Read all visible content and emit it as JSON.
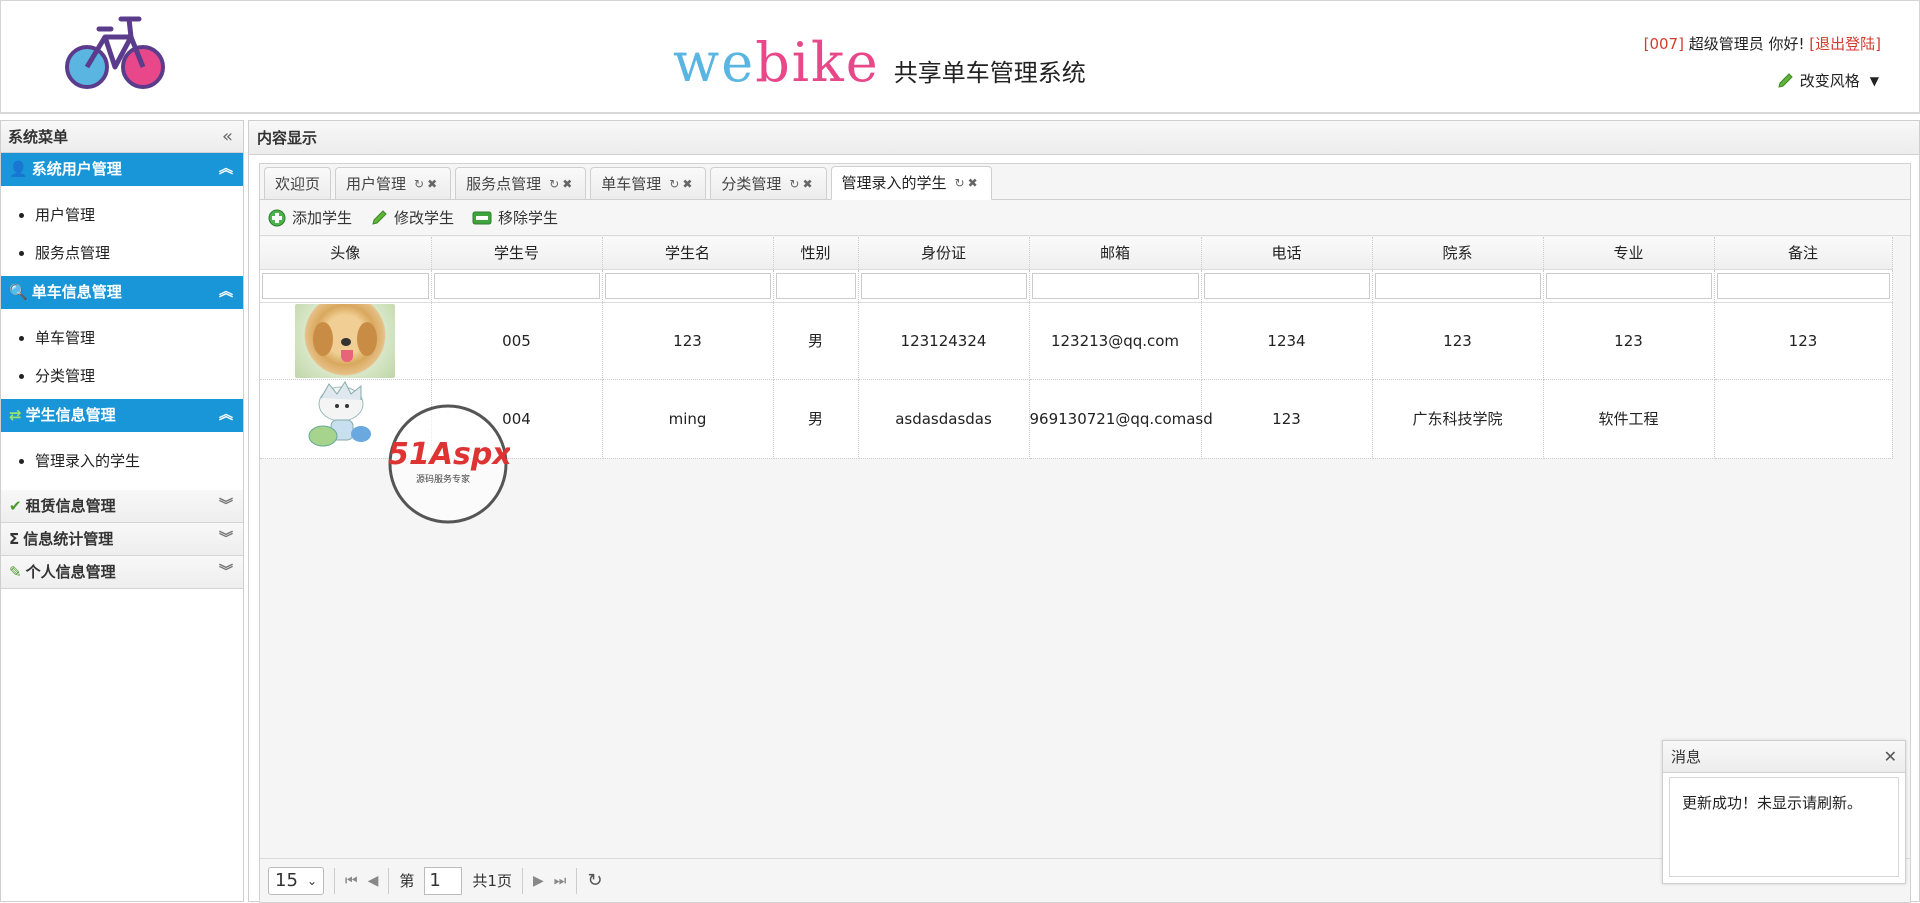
{
  "header": {
    "brand_we": "we",
    "brand_bike": "bike",
    "brand_sub": "共享单车管理系统",
    "user_id": "[007]",
    "user_greeting": " 超级管理员 你好! ",
    "logout": "[退出登陆]",
    "style_switch": "改变风格"
  },
  "sidebar": {
    "title": "系统菜单",
    "groups": [
      {
        "label": "系统用户管理",
        "icon": "user-icon",
        "open": true,
        "items": [
          "用户管理",
          "服务点管理"
        ]
      },
      {
        "label": "单车信息管理",
        "icon": "search-icon",
        "open": true,
        "items": [
          "单车管理",
          "分类管理"
        ]
      },
      {
        "label": "学生信息管理",
        "icon": "refresh-icon",
        "open": true,
        "items": [
          "管理录入的学生"
        ]
      },
      {
        "label": "租赁信息管理",
        "icon": "check-icon",
        "open": false,
        "items": []
      },
      {
        "label": "信息统计管理",
        "icon": "sigma-icon",
        "open": false,
        "items": []
      },
      {
        "label": "个人信息管理",
        "icon": "pencil-icon",
        "open": false,
        "items": []
      }
    ]
  },
  "main": {
    "title": "内容显示",
    "tabs": [
      {
        "label": "欢迎页",
        "closable": false
      },
      {
        "label": "用户管理",
        "closable": true
      },
      {
        "label": "服务点管理",
        "closable": true
      },
      {
        "label": "单车管理",
        "closable": true
      },
      {
        "label": "分类管理",
        "closable": true
      },
      {
        "label": "管理录入的学生",
        "closable": true,
        "active": true
      }
    ],
    "toolbar": {
      "add": "添加学生",
      "edit": "修改学生",
      "remove": "移除学生"
    },
    "columns": [
      "头像",
      "学生号",
      "学生名",
      "性别",
      "身份证",
      "邮箱",
      "电话",
      "院系",
      "专业",
      "备注"
    ],
    "rows": [
      {
        "avatar": "dog-photo",
        "id": "005",
        "name": "123",
        "gender": "男",
        "idcard": "123124324",
        "email": "123213@qq.com",
        "phone": "1234",
        "dept": "123",
        "major": "123",
        "note": "123"
      },
      {
        "avatar": "cartoon-character",
        "id": "004",
        "name": "ming",
        "gender": "男",
        "idcard": "asdasdasdas",
        "email": "969130721@qq.comasd",
        "phone": "123",
        "dept": "广东科技学院",
        "major": "软件工程",
        "note": ""
      }
    ],
    "pager": {
      "page_size": "15",
      "page_prefix": "第",
      "page_value": "1",
      "page_total": "共1页"
    }
  },
  "watermark": {
    "text": "51Aspx",
    "sub": "源码服务专家"
  },
  "toast": {
    "title": "消息",
    "message": "更新成功！未显示请刷新。"
  },
  "colors": {
    "accent": "#1996d8",
    "red": "#d23c2c",
    "brand_blue": "#5ab6e0",
    "brand_pink": "#e8488a"
  }
}
